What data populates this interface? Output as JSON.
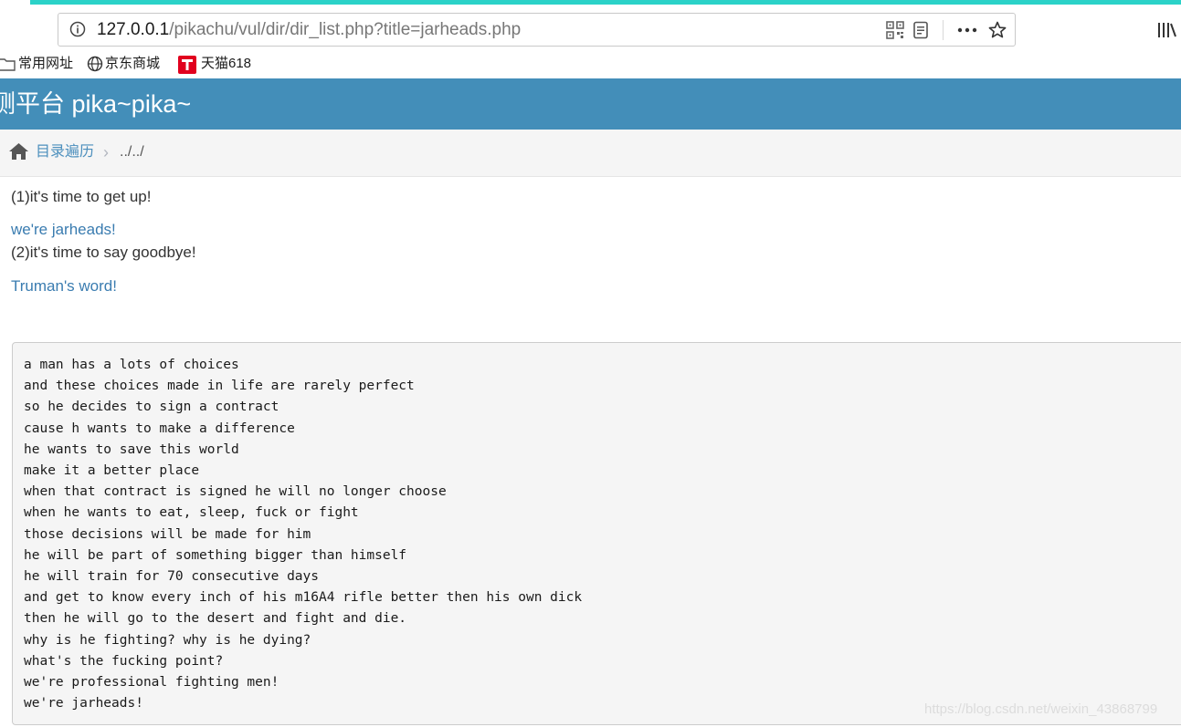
{
  "browser": {
    "url_host": "127.0.0.1",
    "url_path": "/pikachu/vul/dir/dir_list.php?title=jarheads.php",
    "bookmarks": [
      {
        "label": "常用网址",
        "icon": "folder-icon"
      },
      {
        "label": "京东商城",
        "icon": "globe-icon"
      },
      {
        "label": "天猫618",
        "icon": "tmall-icon"
      }
    ]
  },
  "header": {
    "title": "测平台 pika~pika~"
  },
  "breadcrumb": {
    "link": "目录遍历",
    "separator": "›",
    "current": "../../"
  },
  "content": {
    "line1": "(1)it's time to get up!",
    "link1": "we're jarheads!",
    "line2": "(2)it's time to say goodbye!",
    "link2": "Truman's word!",
    "poem": [
      "a man has a lots of choices",
      "and these choices made in life are rarely perfect",
      "so he decides to sign a contract",
      "cause h wants to make a difference",
      "he wants to save this world",
      "make it a better place",
      "when that contract is signed he will no longer choose",
      "when he wants to eat, sleep, fuck or fight",
      "those decisions will be made for him",
      "he will be part of something bigger than himself",
      "he will train for 70 consecutive days",
      "and get to know every inch of his m16A4 rifle better then his own dick",
      "then he will go to the desert and fight and die.",
      "why is he fighting? why is he dying?",
      "what's the fucking point?",
      "we're professional fighting men!",
      "we're jarheads!"
    ]
  },
  "watermark": "https://blog.csdn.net/weixin_43868799",
  "colors": {
    "header": "#438eb9",
    "link": "#3a7cb0",
    "tab_accent": "#2bd2c8"
  }
}
